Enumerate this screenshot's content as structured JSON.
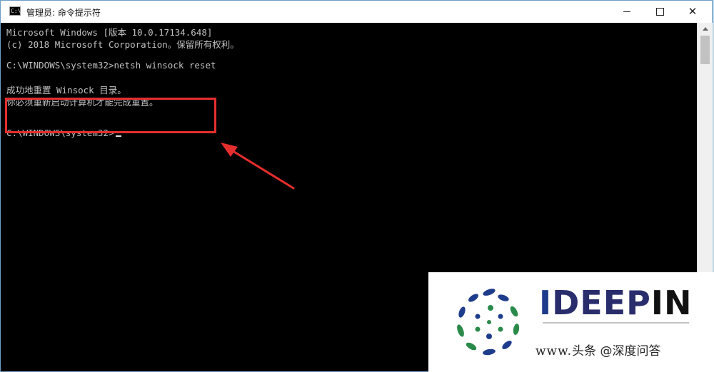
{
  "window": {
    "icon": "console-icon",
    "icon_text": "C:\\",
    "title": "管理员: 命令提示符"
  },
  "console": {
    "lines": [
      "Microsoft Windows [版本 10.0.17134.648]",
      "(c) 2018 Microsoft Corporation。保留所有权利。",
      "C:\\WINDOWS\\system32>netsh winsock reset",
      "成功地重置 Winsock 目录。",
      "你必须重新启动计算机才能完成重置。",
      "C:\\WINDOWS\\system32>"
    ]
  },
  "annotation": {
    "box_color": "#e52e2e",
    "arrow_color": "#e52e2e"
  },
  "watermark": {
    "brand": {
      "i": "I",
      "deep": "DEEP",
      "pin": "IN"
    },
    "footer_prefix": "www.",
    "footer_text": "头条 @深度问答"
  }
}
